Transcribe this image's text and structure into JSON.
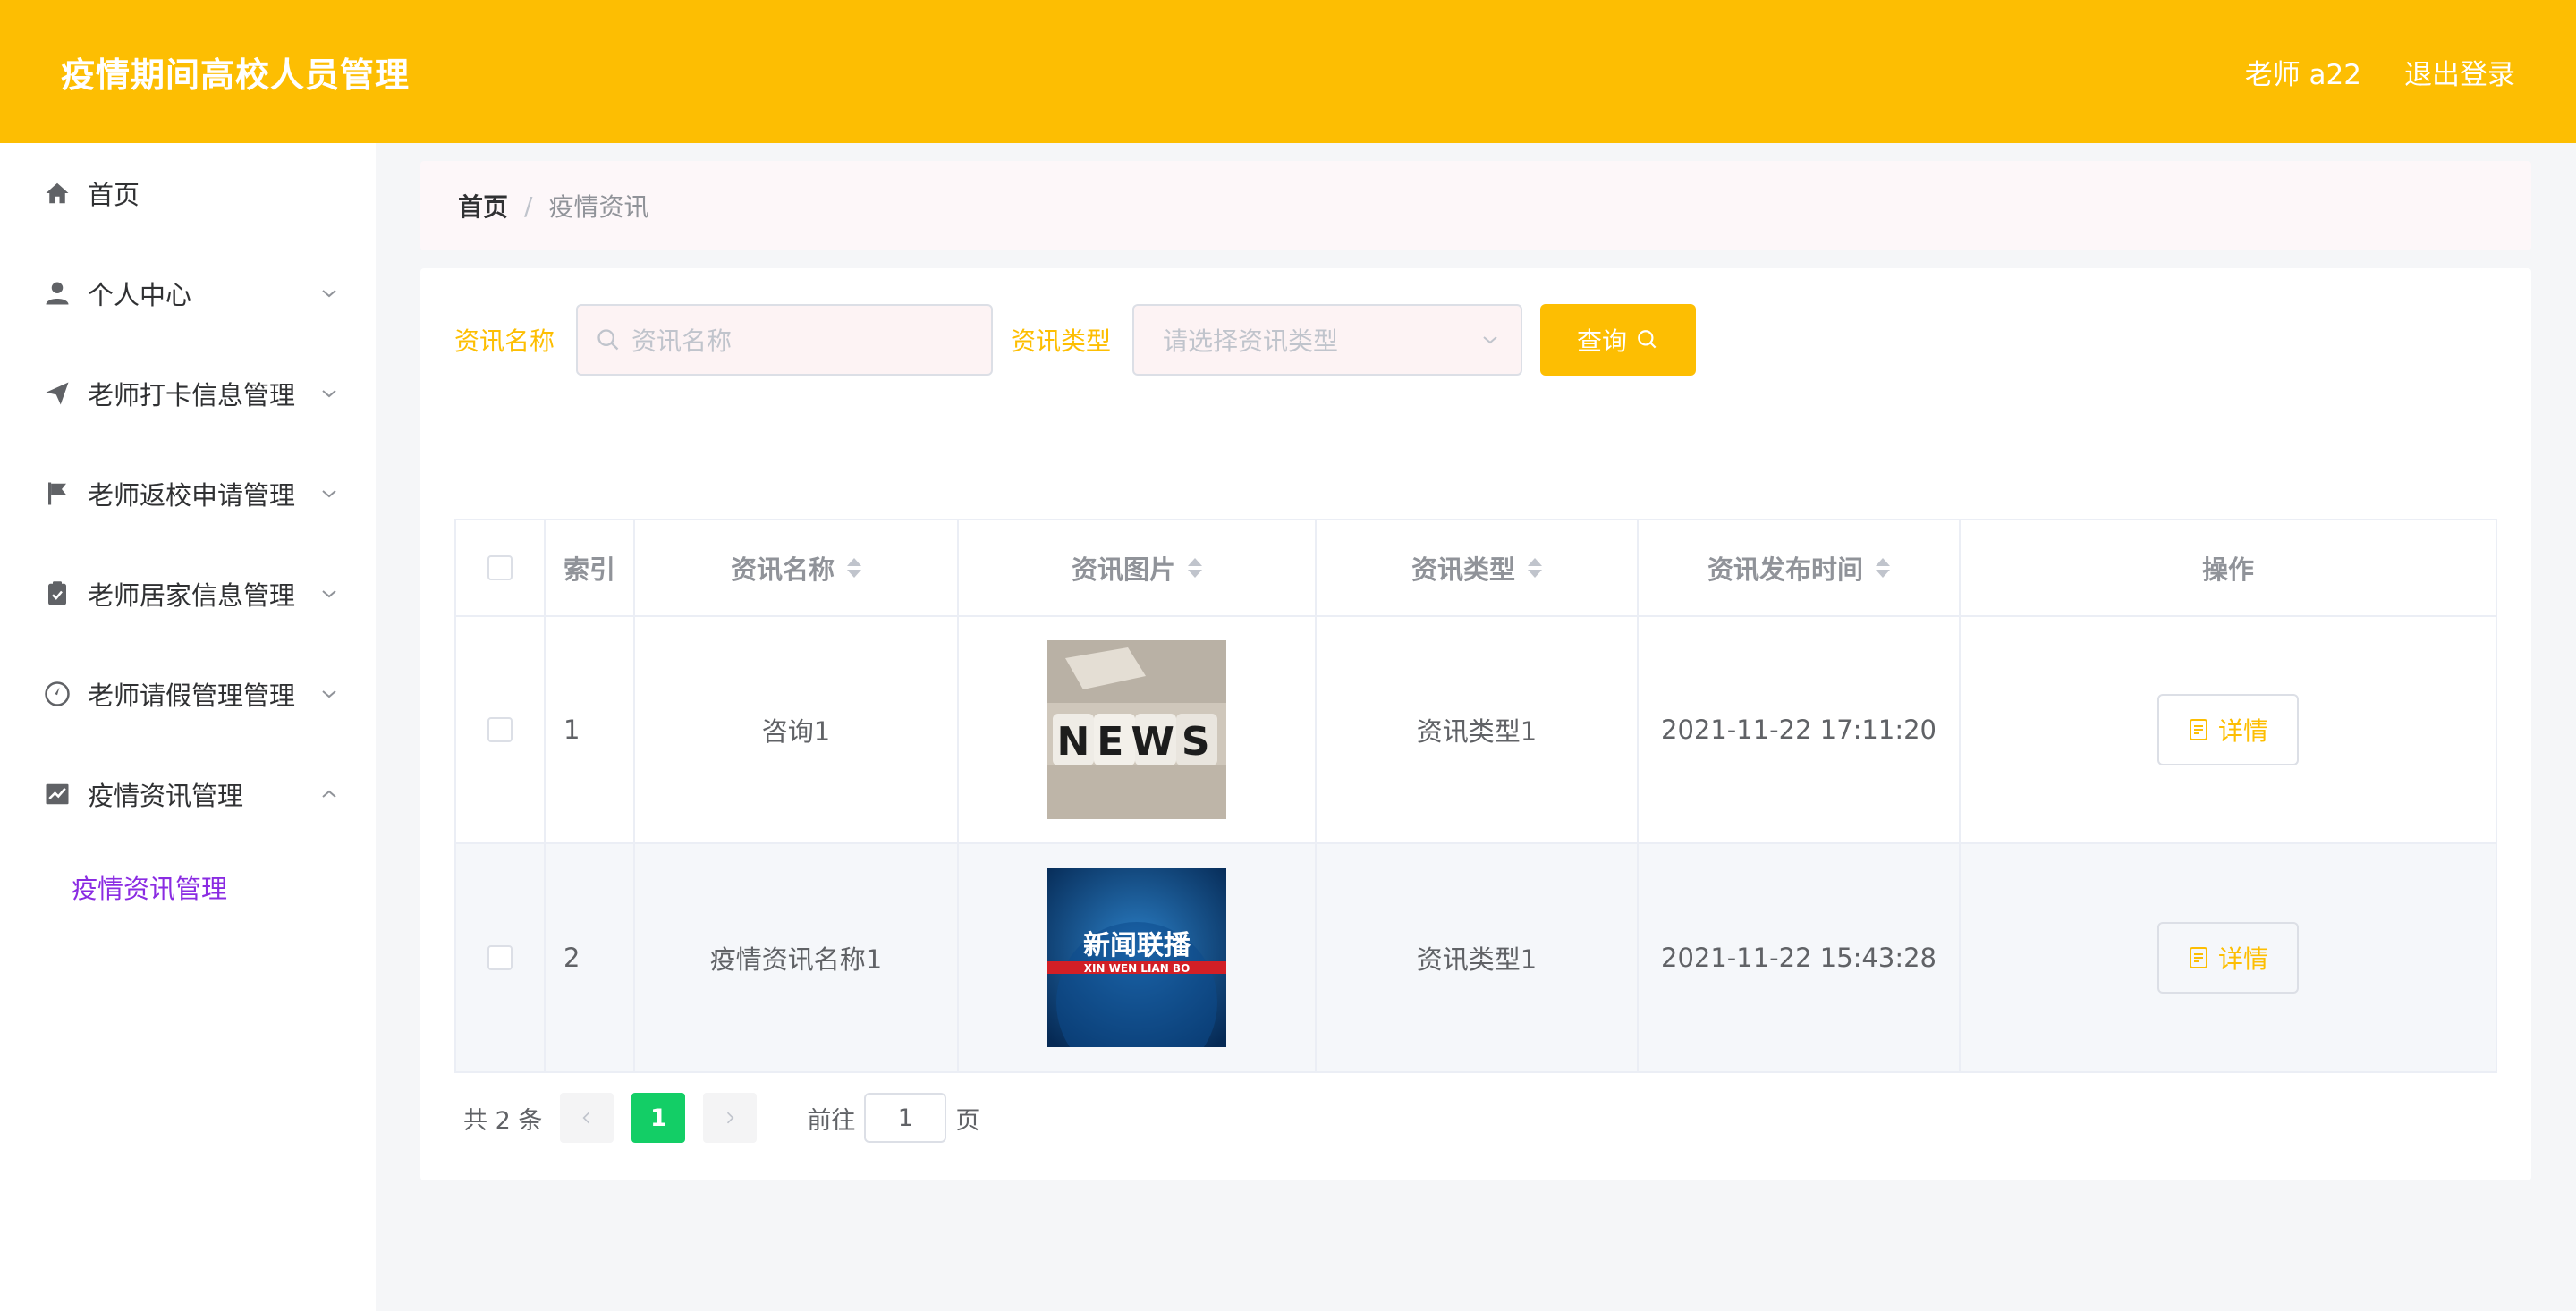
{
  "header": {
    "title": "疫情期间高校人员管理",
    "user": "老师 a22",
    "logout": "退出登录"
  },
  "sidebar": {
    "items": [
      {
        "label": "首页",
        "icon": "home-icon"
      },
      {
        "label": "个人中心",
        "icon": "user-icon"
      },
      {
        "label": "老师打卡信息管理",
        "icon": "send-icon"
      },
      {
        "label": "老师返校申请管理",
        "icon": "flag-icon"
      },
      {
        "label": "老师居家信息管理",
        "icon": "clipboard-check-icon"
      },
      {
        "label": "老师请假管理管理",
        "icon": "compass-icon"
      },
      {
        "label": "疫情资讯管理",
        "icon": "chart-icon"
      }
    ],
    "submenu": "疫情资讯管理"
  },
  "breadcrumb": {
    "home": "首页",
    "separator": "/",
    "current": "疫情资讯"
  },
  "search": {
    "name_label": "资讯名称",
    "name_placeholder": "资讯名称",
    "type_label": "资讯类型",
    "type_placeholder": "请选择资讯类型",
    "button": "查询"
  },
  "table": {
    "headers": [
      "索引",
      "资讯名称",
      "资讯图片",
      "资讯类型",
      "资讯发布时间",
      "操作"
    ],
    "rows": [
      {
        "index": "1",
        "name": "咨询1",
        "image": "news-dice-image",
        "type": "资讯类型1",
        "time": "2021-11-22 17:11:20",
        "action": "详情"
      },
      {
        "index": "2",
        "name": "疫情资讯名称1",
        "image": "xinwen-lianbo-image",
        "type": "资讯类型1",
        "time": "2021-11-22 15:43:28",
        "action": "详情"
      }
    ]
  },
  "image_text": {
    "news": "NEWS",
    "xw_cn": "新闻联播",
    "xw_en": "XIN WEN LIAN BO"
  },
  "pagination": {
    "total": "共 2 条",
    "current": "1",
    "goto": "前往",
    "page_value": "1",
    "page_suffix": "页"
  },
  "colors": {
    "accent": "#fdbe02",
    "submenu_active": "#8a2be2",
    "page_active": "#13ce66"
  }
}
